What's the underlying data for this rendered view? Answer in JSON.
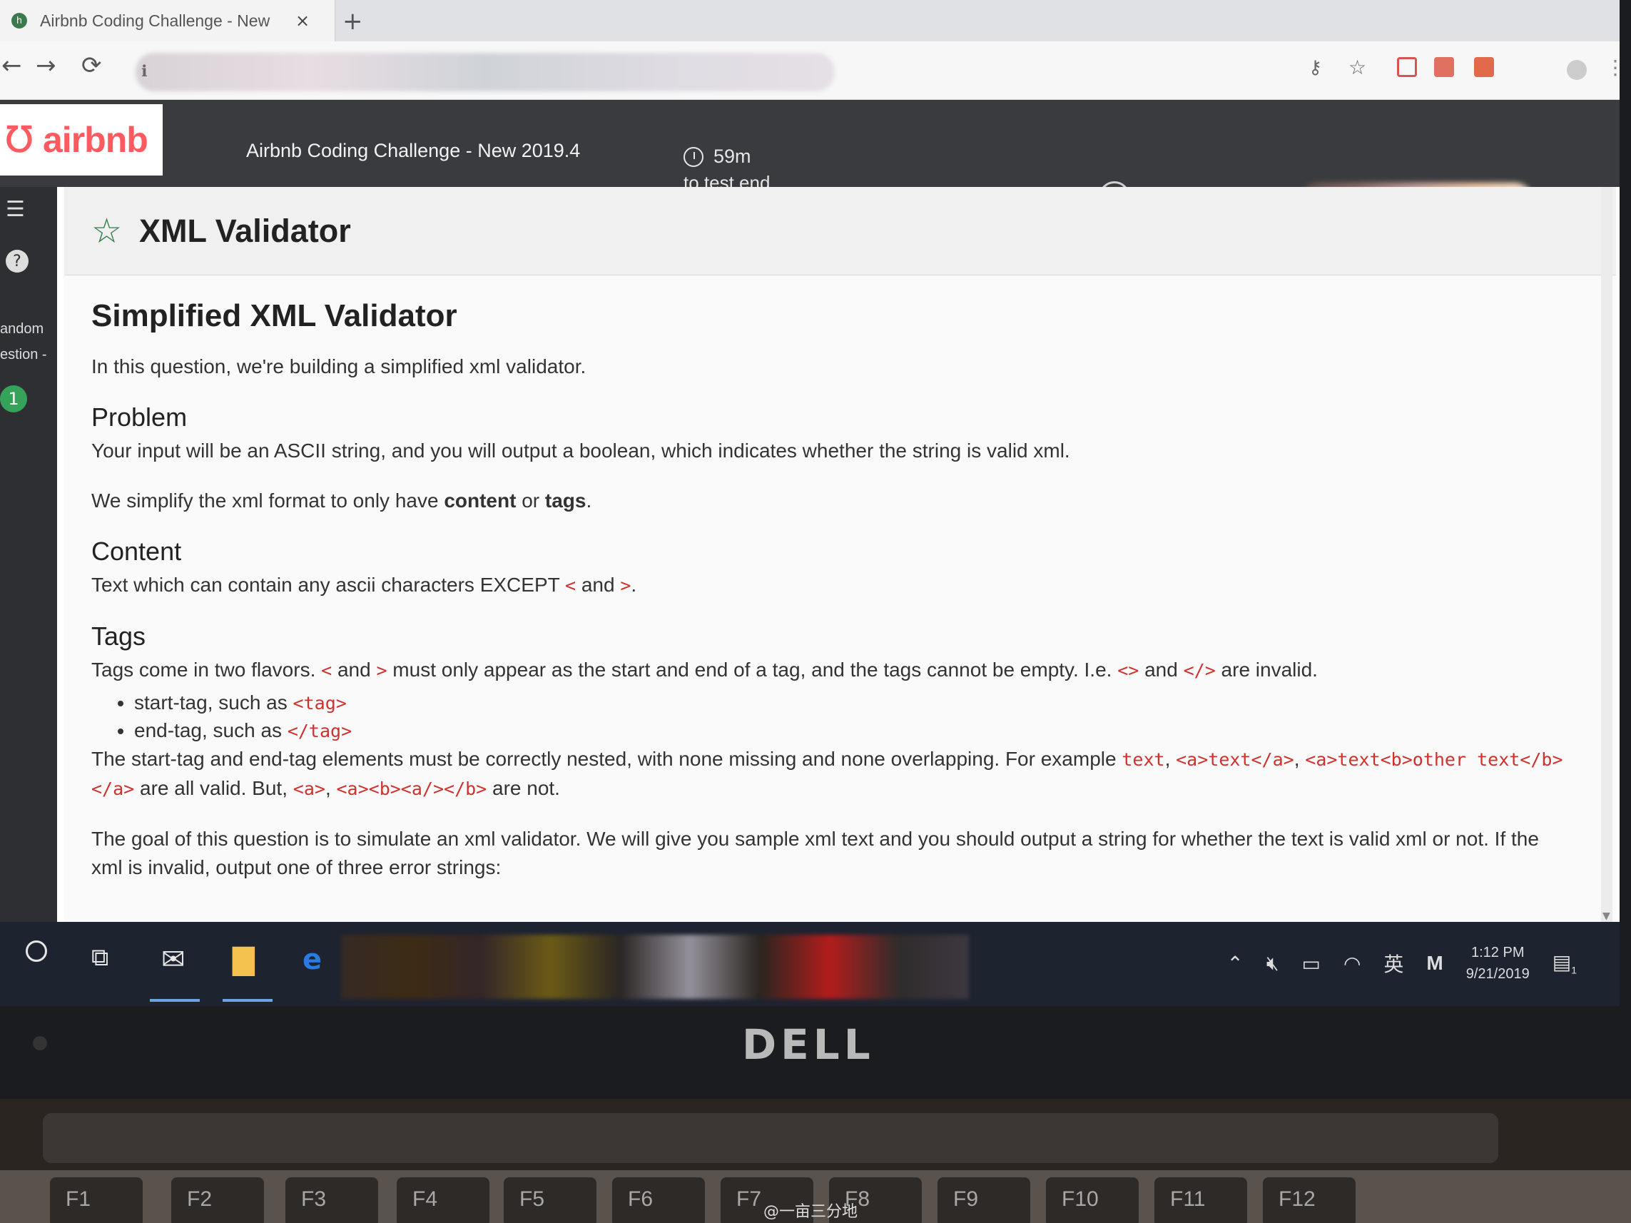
{
  "browser": {
    "tab_title": "Airbnb Coding Challenge - New",
    "tab_close": "×",
    "new_tab": "+",
    "back": "←",
    "forward": "→",
    "reload": "⟳",
    "info": "ℹ"
  },
  "header": {
    "logo_text": "airbnb",
    "challenge_title": "Airbnb Coding Challenge - New 2019.4",
    "timer_value": "59m",
    "timer_caption": "to test end",
    "hr_logo": "h"
  },
  "sidebar": {
    "random_label": "andom",
    "question_label": "estion -",
    "badge": "1"
  },
  "problem": {
    "title": "XML Validator",
    "heading": "Simplified XML Validator",
    "intro": "In this question, we're building a simplified xml validator.",
    "problem_heading": "Problem",
    "problem_text": "Your input will be an ASCII string, and you will output a boolean, which indicates whether the string is valid xml.",
    "simplify_pre": "We simplify the xml format to only have ",
    "simplify_content": "content",
    "simplify_or": " or ",
    "simplify_tags": "tags",
    "simplify_end": ".",
    "content_heading": "Content",
    "content_pre": "Text which can contain any ascii characters EXCEPT ",
    "content_lt": "<",
    "content_and": " and ",
    "content_gt": ">",
    "content_end": ".",
    "tags_heading": "Tags",
    "tags_pre": "Tags come in two flavors. ",
    "tags_lt": "<",
    "tags_and1": " and ",
    "tags_gt": ">",
    "tags_mid": " must only appear as the start and end of a tag, and the tags cannot be empty. I.e. ",
    "tags_empty1": "<>",
    "tags_and2": " and ",
    "tags_empty2": "</>",
    "tags_end": " are invalid.",
    "bullet1_pre": "start-tag, such as ",
    "bullet1_code": "<tag>",
    "bullet2_pre": "end-tag, such as ",
    "bullet2_code": "</tag>",
    "nesting_pre": "The start-tag and end-tag elements must be correctly nested, with none missing and none overlapping.  For example ",
    "ex1": "text",
    "sep1": ", ",
    "ex2": "<a>text</a>",
    "sep2": ", ",
    "ex3": "<a>text<b>other text</b></a>",
    "valid_text": " are all valid.  But, ",
    "bad1": "<a>",
    "sep3": ", ",
    "bad2": "<a><b><a/></b>",
    "invalid_text": " are not.",
    "goal_text": "The goal of this question is to simulate an xml validator. We will give you sample xml text and you should output a string for whether the text is valid xml or not.  If the",
    "goal_cut": "xml is invalid, output one of three error strings:"
  },
  "taskbar": {
    "ime": "英",
    "time": "1:12 PM",
    "date": "9/21/2019",
    "notifications": "1"
  },
  "laptop": {
    "brand": "DELL",
    "keys": [
      "F1",
      "F2",
      "F3",
      "F4",
      "F5",
      "F6",
      "F7",
      "F8",
      "F9",
      "F10",
      "F11",
      "F12"
    ],
    "watermark": "@一亩三分地"
  }
}
